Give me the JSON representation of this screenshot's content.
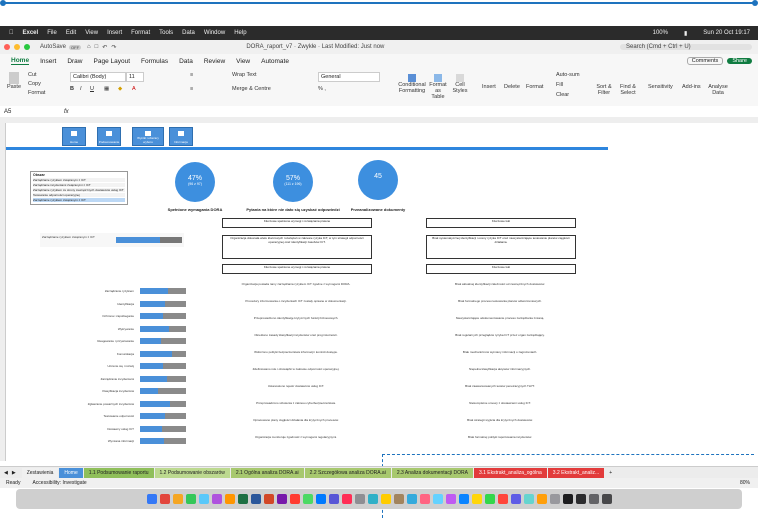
{
  "mac_menu": {
    "app": "Excel",
    "items": [
      "File",
      "Edit",
      "View",
      "Insert",
      "Format",
      "Tools",
      "Data",
      "Window",
      "Help"
    ],
    "battery": "100%",
    "datetime": "Sun 20 Oct 19:17"
  },
  "window": {
    "autosave": "AutoSave",
    "autosave_state": "OFF",
    "title": "DORA_raport_v7 · Zwykłe · Last Modified: Just now",
    "search_placeholder": "Search (Cmd + Ctrl + U)"
  },
  "ribbon_tabs": [
    "Home",
    "Insert",
    "Draw",
    "Page Layout",
    "Formulas",
    "Data",
    "Review",
    "View",
    "Automate"
  ],
  "ribbon_right": {
    "comments": "Comments",
    "share": "Share"
  },
  "ribbon": {
    "paste": "Paste",
    "cut": "Cut",
    "copy": "Copy",
    "format": "Format",
    "font_name": "Calibri (Body)",
    "font_size": "11",
    "wrap_text": "Wrap Text",
    "merge": "Merge & Centre",
    "number_format": "General",
    "conditional": "Conditional Formatting",
    "format_table": "Format as Table",
    "cell_styles": "Cell Styles",
    "insert": "Insert",
    "delete": "Delete",
    "format_cells": "Format",
    "autosum": "Auto-sum",
    "fill": "Fill",
    "clear": "Clear",
    "sort_filter": "Sort & Filter",
    "find_select": "Find & Select",
    "sensitivity": "Sensitivity",
    "addins": "Add-ins",
    "analyse": "Analyse Data"
  },
  "formula_bar": {
    "cell_ref": "A5",
    "fx": "fx",
    "value": ""
  },
  "nav_buttons": [
    "Home",
    "Podsumowanie",
    "Wyniki i obszary wyboru",
    "Informacje"
  ],
  "kpis": [
    {
      "value": "47%",
      "sub": "(96 z 97)",
      "caption": "Spełnione wymagania DORA"
    },
    {
      "value": "57%",
      "sub": "(111 z 196)",
      "caption": "Pytania na które nie dało się uzyskać odpowiedzi"
    },
    {
      "value": "45",
      "sub": "",
      "caption": "Przeanalizowane dokumenty"
    }
  ],
  "filter": {
    "title": "Obszar",
    "items": [
      "Zarządzanie ryzykiem związanym z ICT",
      "Zarządzanie incydentami związanymi z ICT",
      "Zarządzanie ryzykiem ze strony zewnętrznych dostawców usług ICT",
      "Testowanie odporności operacyjnej",
      "Zarządzanie ryzykiem związanym z ICT"
    ]
  },
  "small_chart_label": "Zarządzanie ryzykiem związanym z ICT",
  "bar_rows": [
    {
      "label": "Zarządzanie ryzykiem",
      "fill": 0.6
    },
    {
      "label": "Identyfikacja",
      "fill": 0.55
    },
    {
      "label": "Ochrona i zapobieganie",
      "fill": 0.5
    },
    {
      "label": "Wykrywanie",
      "fill": 0.62
    },
    {
      "label": "Reagowanie i przywracanie",
      "fill": 0.45
    },
    {
      "label": "Komunikacja",
      "fill": 0.7
    },
    {
      "label": "Uczenie się i rozwój",
      "fill": 0.5
    },
    {
      "label": "Zarządzanie incydentami",
      "fill": 0.58
    },
    {
      "label": "Klasyfikacja incydentów",
      "fill": 0.4
    },
    {
      "label": "Zgłaszanie poważnych incydentów",
      "fill": 0.65
    },
    {
      "label": "Testowanie odporności",
      "fill": 0.55
    },
    {
      "label": "Dostawcy usług ICT",
      "fill": 0.48
    },
    {
      "label": "Wymiana informacji",
      "fill": 0.52
    }
  ],
  "boxes": {
    "mid_top": "Kluczowe spełnione wymogi i rozwiązania prawne",
    "mid_body": "Organizacja dokonała wielu kluczowych rozwiązań w zakresie ryzyka ICT, w tym strategii odporności operacyjnej oraz identyfikacji zasobów ICT.",
    "mid_low": "Kluczowe spełnione wymogi i rozwiązania prawne",
    "right_top": "Kluczowe luki",
    "right_body": "Brak systematycznej identyfikacji i oceny ryzyka ICT oraz niewystarczające testowanie planów ciągłości działania.",
    "right_low": "Kluczowe luki"
  },
  "mid_paras": [
    "Organizacja posiada ramy zarządzania ryzykiem ICT zgodne z wymogami DORA.",
    "Procedury informowania o incydentach ICT zostały opisane w dokumentacji.",
    "Przeprowadzono identyfikację krytycznych funkcji biznesowych.",
    "Określono zasady klasyfikacji incydentów oraz progi istotności.",
    "Wdrożono polityki bezpieczeństwa informacji i kontroli dostępu.",
    "Zdefiniowano role i obowiązki w zakresie odporności operacyjnej.",
    "Ustanowiono rejestr dostawców usług ICT.",
    "Przeprowadzono szkolenia z zakresu cyberbezpieczeństwa.",
    "Opracowano plany ciągłości działania dla krytycznych procesów.",
    "Organizacja monitoruje zgodność z wymogami regulacyjnymi."
  ],
  "right_paras": [
    "Brak aktualnej identyfikacji zależności od zewnętrznych dostawców.",
    "Brak formalnego procesu testowania planów odtworzeniowych.",
    "Niewystarczające udokumentowanie procesu zarządzania zmianą.",
    "Brak regularnych przeglądów ryzyka ICT przez organ zarządzający.",
    "Brak mechanizmów wymiany informacji o zagrożeniach.",
    "Niepełna klasyfikacja aktywów informacyjnych.",
    "Brak zaawansowanych testów penetracyjnych TLPT.",
    "Niekompletne umowy z dostawcami usług ICT.",
    "Brak strategii wyjścia dla krytycznych dostawców.",
    "Brak formalnej polityki raportowania incydentów."
  ],
  "sheet_tabs": [
    {
      "label": "Zestawienia",
      "color": "#f0f0f0",
      "text": "#222"
    },
    {
      "label": "Home",
      "color": "#4a90d9",
      "text": "#fff"
    },
    {
      "label": "1.1 Podsumowanie raportu",
      "color": "#8fbf5a",
      "text": "#222"
    },
    {
      "label": "1.2 Podsumowanie obszarów",
      "color": "#bcd98f",
      "text": "#222"
    },
    {
      "label": "2.1 Ogólna analiza DORA.ai",
      "color": "#a7c86e",
      "text": "#222"
    },
    {
      "label": "2.2 Szczegółowa analiza DORA.ai",
      "color": "#a7c86e",
      "text": "#222"
    },
    {
      "label": "2.3 Analiza dokumentacji DORA",
      "color": "#a7c86e",
      "text": "#222"
    },
    {
      "label": "3.1 Ekstrakt_analiza_ogólna",
      "color": "#e23b3b",
      "text": "#fff"
    },
    {
      "label": "3.2 Ekstrakt_analiz...",
      "color": "#e23b3b",
      "text": "#fff"
    }
  ],
  "status": {
    "ready": "Ready",
    "accessibility": "Accessibility: Investigate",
    "zoom": "80%"
  },
  "dock_colors": [
    "#3478f6",
    "#e2453c",
    "#f5a623",
    "#34c759",
    "#5ac8fa",
    "#af52de",
    "#ff9500",
    "#1d6f42",
    "#2b579a",
    "#d24726",
    "#7719aa",
    "#ff3b30",
    "#4cd964",
    "#007aff",
    "#5856d6",
    "#ff2d55",
    "#8e8e93",
    "#30b0c7",
    "#ffcc00",
    "#a2845e",
    "#34aadc",
    "#ff6482",
    "#64d2ff",
    "#bf5af2",
    "#0a84ff",
    "#ffd60a",
    "#32d74b",
    "#ff453a",
    "#5e5ce6",
    "#66d4cf",
    "#ff9f0a",
    "#98989d",
    "#1c1c1e",
    "#2c2c2e",
    "#636366",
    "#48484a"
  ]
}
